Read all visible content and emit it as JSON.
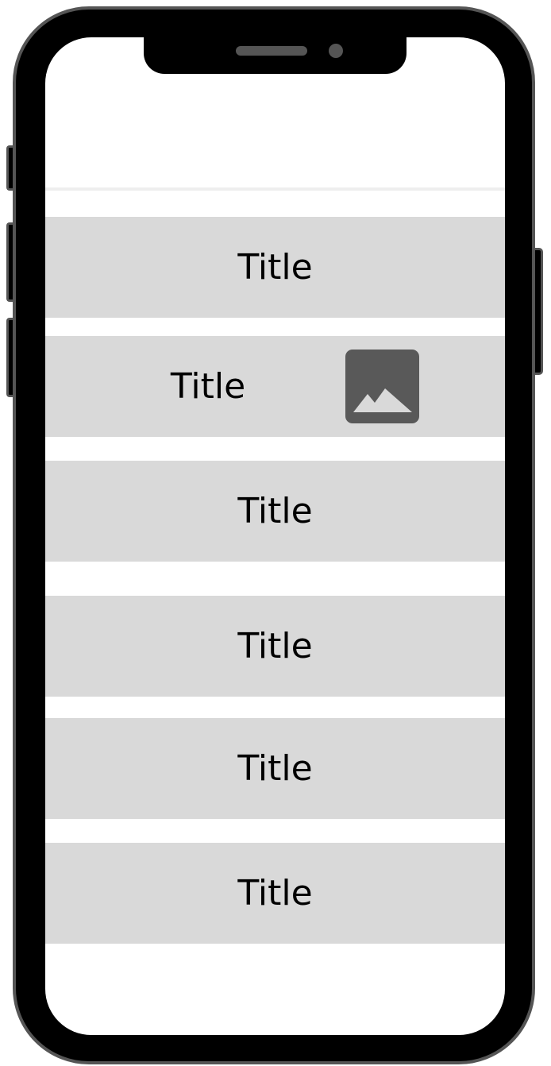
{
  "list": {
    "items": [
      {
        "title": "Title"
      },
      {
        "title": "Title",
        "icon": "image-icon"
      },
      {
        "title": "Title"
      },
      {
        "title": "Title"
      },
      {
        "title": "Title"
      },
      {
        "title": "Title"
      }
    ]
  },
  "colors": {
    "frame": "#000000",
    "frame_border": "#555555",
    "screen": "#ffffff",
    "item_background": "#d9d9d9",
    "thumbnail": "#595959",
    "text": "#000000"
  }
}
